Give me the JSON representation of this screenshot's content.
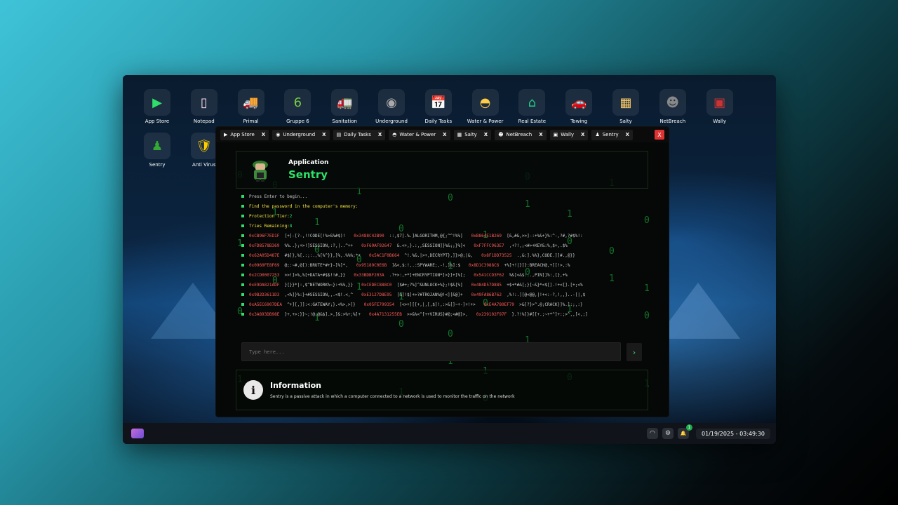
{
  "desktop": {
    "icons": [
      {
        "label": "App Store",
        "glyph": "▶",
        "color": "#2ee06a"
      },
      {
        "label": "Notepad",
        "glyph": "▯",
        "color": "#fde"
      },
      {
        "label": "Primal",
        "glyph": "🚚",
        "color": "#f80"
      },
      {
        "label": "Gruppe 6",
        "glyph": "6",
        "color": "#7c4"
      },
      {
        "label": "Sanitation",
        "glyph": "🚛",
        "color": "#6c4"
      },
      {
        "label": "Underground",
        "glyph": "◉",
        "color": "#aaa"
      },
      {
        "label": "Daily Tasks",
        "glyph": "📅",
        "color": "#ccc"
      },
      {
        "label": "Water & Power",
        "glyph": "◓",
        "color": "#fc4"
      },
      {
        "label": "Real Estate",
        "glyph": "⌂",
        "color": "#2c8"
      },
      {
        "label": "Towing",
        "glyph": "🚗",
        "color": "#d33"
      },
      {
        "label": "Salty",
        "glyph": "▦",
        "color": "#fc6"
      },
      {
        "label": "NetBreach",
        "glyph": "☻",
        "color": "#888"
      },
      {
        "label": "Wally",
        "glyph": "▣",
        "color": "#c33"
      },
      {
        "label": "Sentry",
        "glyph": "♟",
        "color": "#3a3"
      },
      {
        "label": "Anti Virus",
        "glyph": "🛡",
        "color": "#fc0"
      }
    ]
  },
  "tabs": [
    {
      "label": "App Store",
      "icon": "▶"
    },
    {
      "label": "Underground",
      "icon": "◉"
    },
    {
      "label": "Daily Tasks",
      "icon": "▤"
    },
    {
      "label": "Water & Power",
      "icon": "◓"
    },
    {
      "label": "Salty",
      "icon": "▦"
    },
    {
      "label": "NetBreach",
      "icon": "☻"
    },
    {
      "label": "Wally",
      "icon": "▣"
    },
    {
      "label": "Sentry",
      "icon": "♟"
    }
  ],
  "tab_close": "X",
  "close_all": "X",
  "header": {
    "subtitle": "Application",
    "title": "Sentry"
  },
  "terminal": {
    "lines": [
      {
        "text": "Press Enter to begin...",
        "cls": ""
      },
      {
        "text": "Find the password in the computer's memory:",
        "cls": "y"
      },
      {
        "label": "Protection Tier:",
        "value": "2"
      },
      {
        "label": "Tries Remaining:",
        "value": "8"
      }
    ],
    "memory": [
      [
        [
          "0xCB96F7ED1F",
          "[+]-[?-,!!CODE[!%>&%#$)!"
        ],
        [
          "0x3488C42B90",
          "::,$7].%.]ALGORITHM,@{;^^!%%]"
        ],
        [
          "0xB864E1B269",
          "[&,#&,>>]-:+%&+}%:^-,?#,?#$%!:"
        ]
      ],
      [
        [
          "0xFD8578B369",
          "%%..};+>!]SESSION,:?,|..^++"
        ],
        [
          "0xF69AF92647",
          "&.<+,}.:,,SESSION]}%&;;}%]<"
        ],
        [
          "0xF7FFC963E7",
          ",+?!,;<#>+KEY&:%,$+,.$%"
        ]
      ],
      [
        [
          "0x62A05D487E",
          "#$]},%[.:;:.,%[%^}},]%,.%%%;*+"
        ],
        [
          "0x5AC1F0B664",
          "^!.%&.|>+,DECRYPT},]}>@;|&,"
        ],
        [
          "0x8F1DD73525",
          ".,&:].%%},CODE.]]#.,@}}"
        ]
      ],
      [
        [
          "0x0960FE8F69",
          "@;:~#,@[):BRUTE*#+}-]%]*,"
        ],
        [
          "0x95189C0E6B",
          "]&<,$:!,.:SPYWARE;,-!,]%]:$"
        ],
        [
          "0x8D1C3988C6",
          "+%]+!|}]}:BREACH@,+[[!>,:%"
        ]
      ],
      [
        [
          "0x2CD0007253",
          ">>!]>%,%[+DATA+#$$!!#,}}"
        ],
        [
          "0x33BDBF203A",
          ".?+>:,+*]+ENCRYPTION*]>}]+]%[;"
        ],
        [
          "0x541CCD3F62",
          "%&]<&$:..,PIN]]%:,[},+%"
        ]
      ],
      [
        [
          "0xE9DA821ADF",
          "}[}}*|:,$^NETWORK%~}:+%%,}}"
        ],
        [
          "0xCEDEC888C0",
          "[$#+;?%]^&UNLOCK+%};!$&[%]"
        ],
        [
          "0x484D57D885",
          "+$+*#&[;}[~&}*<$[].!+<[].[+;<%"
        ]
      ],
      [
        [
          "0x9B2D3611D3",
          ",<%]}%:}+#SESSION,,.<$!.<,^"
        ],
        [
          "0xE3127D8E95",
          "[&]!$]+>?#TROJAN%@!<][&@]+"
        ],
        [
          "0x49FA86B762",
          ",%!:.][@<@@,|!+<:-?,!,,]..-[|,$"
        ]
      ],
      [
        [
          "0xA5EC6907DEA",
          "^+][,]]:<:GATEWAY;}.<%>,>[}"
        ],
        [
          "0x05FE799354",
          "[<>+][[+,|,[,$]!,:>&[]~+-]+!+>"
        ],
        [
          "0xE4A780EF79",
          ">&[?}>^.@;CRACK}]%.]:;,:}"
        ]
      ],
      [
        [
          "0x3A893DB98E",
          "}+,+>:}}~;!@,@&$].>,]&:>%+;%]+"
        ],
        [
          "0x4A7131255EB",
          ">>&%<^[++VIRUS}#@;<#@}>,"
        ],
        [
          "0x239102F97F",
          "}.?!%]}#[[+.;~+*^]+:;>^,,[<,;]"
        ]
      ]
    ]
  },
  "input": {
    "placeholder": "Type here..."
  },
  "send_icon": "›",
  "info": {
    "icon": "i",
    "title": "Information",
    "text": "Sentry is a passive attack in which a computer connected to a network is used to monitor the traffic on the network"
  },
  "taskbar": {
    "wifi_icon": "◠",
    "gear_icon": "⚙",
    "bell_icon": "🔔",
    "badge": "1",
    "clock": "01/19/2025 - 03:49:30"
  }
}
